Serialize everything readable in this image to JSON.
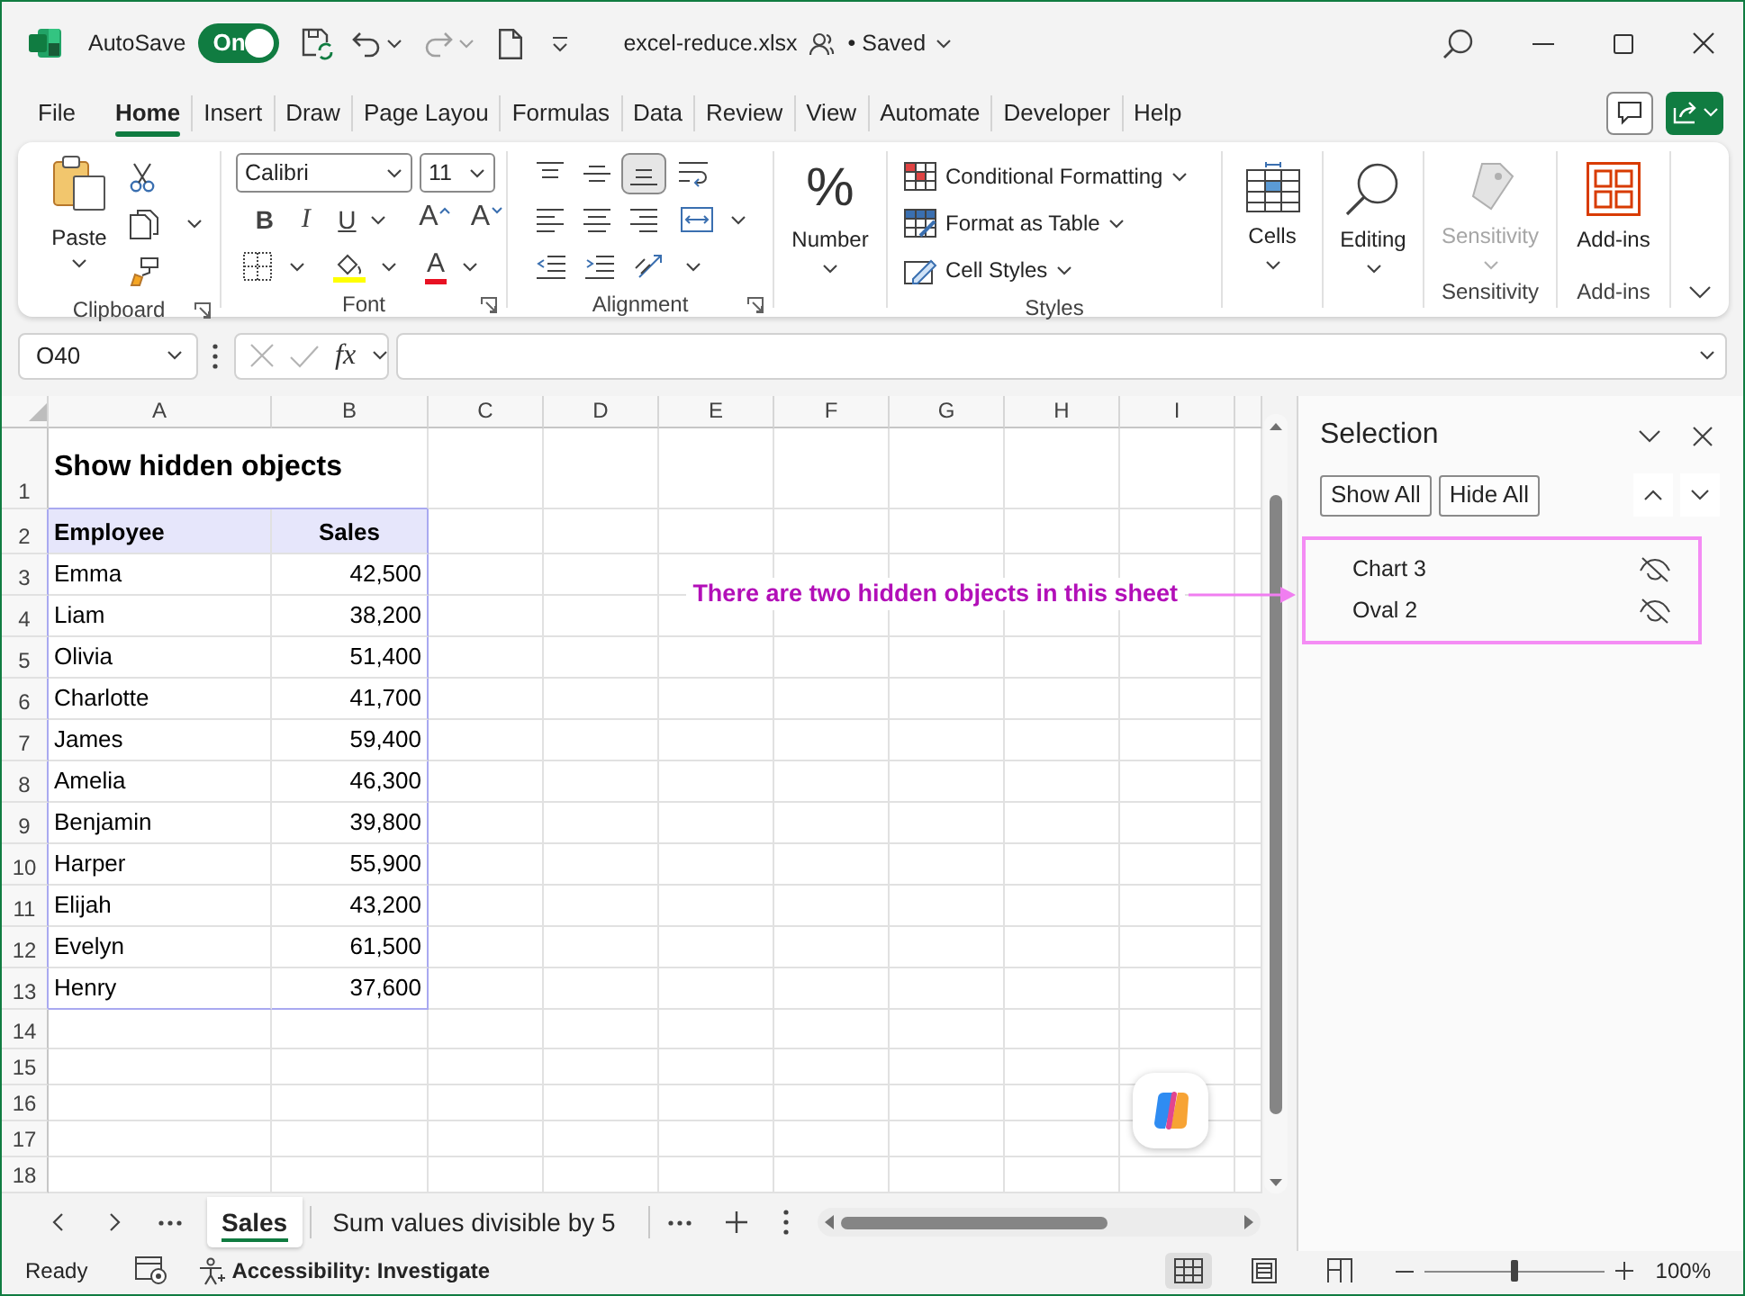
{
  "window": {
    "title": "excel-reduce.xlsx",
    "save_status": "• Saved"
  },
  "autosave": {
    "label": "AutoSave",
    "state": "On",
    "on": true
  },
  "menu_tabs": [
    {
      "label": "File",
      "selected": false
    },
    {
      "label": "Home",
      "selected": true
    },
    {
      "label": "Insert",
      "selected": false
    },
    {
      "label": "Draw",
      "selected": false
    },
    {
      "label": "Page Layou",
      "selected": false
    },
    {
      "label": "Formulas",
      "selected": false
    },
    {
      "label": "Data",
      "selected": false
    },
    {
      "label": "Review",
      "selected": false
    },
    {
      "label": "View",
      "selected": false
    },
    {
      "label": "Automate",
      "selected": false
    },
    {
      "label": "Developer",
      "selected": false
    },
    {
      "label": "Help",
      "selected": false
    }
  ],
  "ribbon": {
    "clipboard": {
      "paste": "Paste",
      "label": "Clipboard"
    },
    "font": {
      "name": "Calibri",
      "size": "11",
      "style_buttons": [
        {
          "kind": "bold",
          "text": "B"
        },
        {
          "kind": "italic",
          "text": "I"
        },
        {
          "kind": "underline",
          "text": "U"
        }
      ],
      "grow": "A",
      "shrink": "A",
      "font_color": "A",
      "label": "Font"
    },
    "alignment": {
      "vertical": [
        {
          "kind": "top",
          "selected": false
        },
        {
          "kind": "middle",
          "selected": false
        },
        {
          "kind": "bottom",
          "selected": true
        }
      ],
      "horizontal": [
        {
          "kind": "left",
          "selected": false
        },
        {
          "kind": "center",
          "selected": false
        },
        {
          "kind": "right",
          "selected": false
        }
      ],
      "label": "Alignment"
    },
    "number": {
      "symbol": "%",
      "button": "Number"
    },
    "styles": {
      "items": [
        {
          "kind": "conditional",
          "label": "Conditional Formatting"
        },
        {
          "kind": "table",
          "label": "Format as Table"
        },
        {
          "kind": "cell_styles",
          "label": "Cell Styles"
        }
      ],
      "label": "Styles"
    },
    "cells": {
      "button": "Cells"
    },
    "editing": {
      "button": "Editing"
    },
    "sensitivity": {
      "button": "Sensitivity",
      "disabled": true,
      "label": "Sensitivity"
    },
    "addins": {
      "button": "Add-ins",
      "label": "Add-ins"
    }
  },
  "formula_bar": {
    "name_box": "O40",
    "fx": "fx"
  },
  "sheet": {
    "columns": [
      "A",
      "B",
      "C",
      "D",
      "E",
      "F",
      "G",
      "H",
      "I"
    ],
    "rows": [
      "1",
      "2",
      "3",
      "4",
      "5",
      "6",
      "7",
      "8",
      "9",
      "10",
      "11",
      "12",
      "13",
      "14",
      "15",
      "16",
      "17",
      "18"
    ],
    "title": "Show hidden objects",
    "table": {
      "columns": [
        "Employee",
        "Sales"
      ],
      "rows": [
        [
          "Emma",
          "42,500"
        ],
        [
          "Liam",
          "38,200"
        ],
        [
          "Olivia",
          "51,400"
        ],
        [
          "Charlotte",
          "41,700"
        ],
        [
          "James",
          "59,400"
        ],
        [
          "Amelia",
          "46,300"
        ],
        [
          "Benjamin",
          "39,800"
        ],
        [
          "Harper",
          "55,900"
        ],
        [
          "Elijah",
          "43,200"
        ],
        [
          "Evelyn",
          "61,500"
        ],
        [
          "Henry",
          "37,600"
        ]
      ]
    }
  },
  "annotation": {
    "text": "There are two hidden objects in this sheet"
  },
  "sheet_tabs": [
    {
      "label": "Sales",
      "selected": true
    },
    {
      "label": "Sum values divisible by 5",
      "selected": false
    }
  ],
  "selection_pane": {
    "title": "Selection",
    "buttons": [
      "Show All",
      "Hide All"
    ],
    "items": [
      {
        "name": "Chart 3",
        "visible": false
      },
      {
        "name": "Oval 2",
        "visible": false
      }
    ]
  },
  "status_bar": {
    "status": "Ready",
    "accessibility": "Accessibility: Investigate",
    "views": [
      {
        "kind": "normal",
        "selected": true
      },
      {
        "kind": "page_layout",
        "selected": false
      },
      {
        "kind": "page_break",
        "selected": false
      }
    ],
    "zoom": {
      "level": 0.5,
      "reading": "100%"
    }
  }
}
